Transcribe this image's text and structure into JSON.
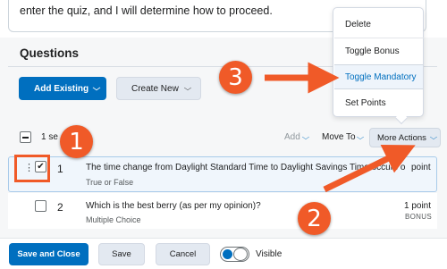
{
  "instructions": {
    "text": "enter the quiz, and I will determine how to proceed."
  },
  "section": {
    "title": "Questions"
  },
  "buttons": {
    "add_existing": "Add Existing",
    "create_new": "Create New"
  },
  "toolbar": {
    "selected_prefix": "1 se",
    "add": "Add",
    "move_to": "Move To",
    "more_actions": "More Actions"
  },
  "questions": [
    {
      "number": "1",
      "title": "The time change from Daylight Standard Time to Daylight Savings Time occurs o",
      "type": "True or False",
      "points": "point",
      "badge": "",
      "selected": true
    },
    {
      "number": "2",
      "title": "Which is the best berry (as per my opinion)?",
      "type": "Multiple Choice",
      "points": "1 point",
      "badge": "BONUS",
      "selected": false
    }
  ],
  "menu": {
    "items": [
      "Delete",
      "Toggle Bonus",
      "Toggle Mandatory",
      "Set Points"
    ],
    "highlighted": "Toggle Mandatory"
  },
  "footer": {
    "save_and_close": "Save and Close",
    "save": "Save",
    "cancel": "Cancel",
    "visible_label": "Visible",
    "visible": true
  },
  "annotations": {
    "labels": [
      "1",
      "2",
      "3"
    ],
    "color": "#f05a28"
  },
  "colors": {
    "primary": "#006fbf",
    "annotation": "#f05a28",
    "selected_row": "#f0f6fc"
  }
}
